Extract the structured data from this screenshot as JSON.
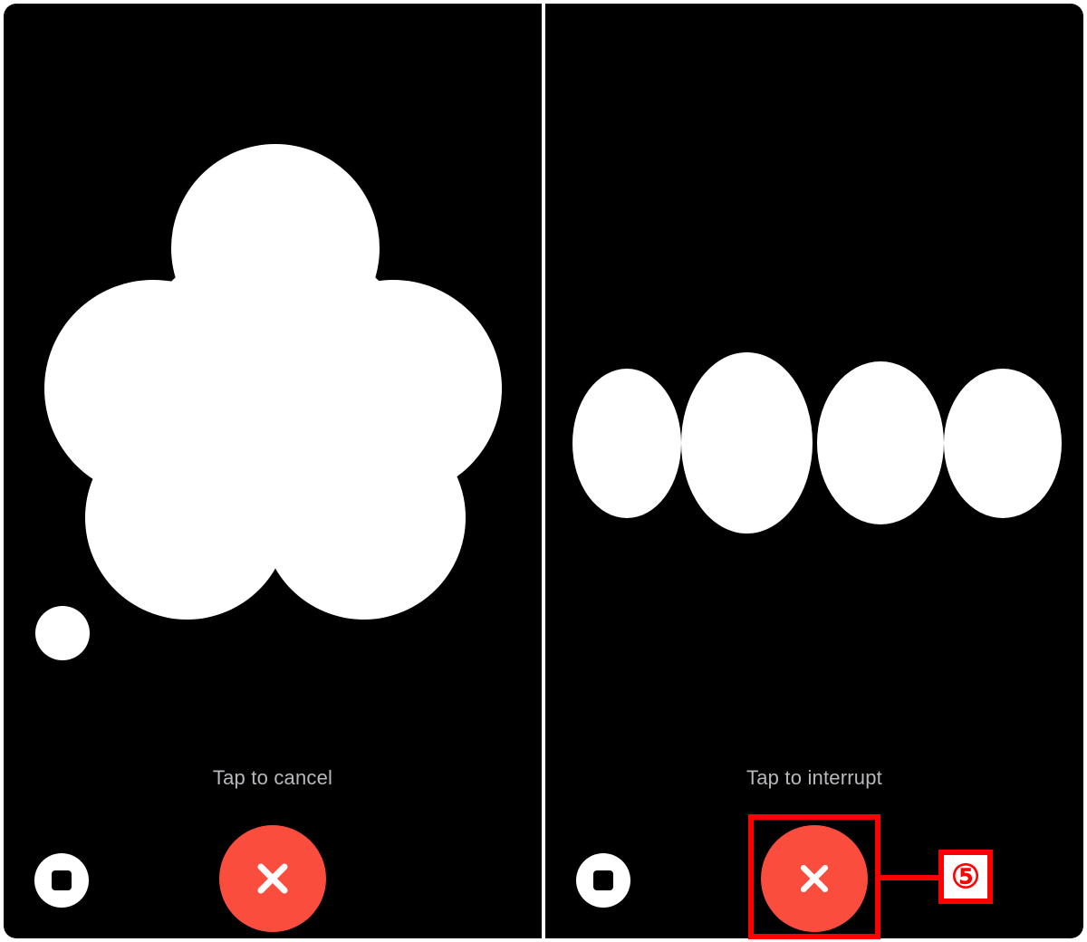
{
  "colors": {
    "accent_red": "#fb4d3d",
    "annotation_red": "#ff0000",
    "hint_text": "#b8b8be",
    "panel_bg": "#000000",
    "bubble_fill": "#ffffff"
  },
  "left_panel": {
    "hint_text": "Tap to cancel",
    "stop_icon": "stop-icon",
    "close_icon": "close-icon"
  },
  "right_panel": {
    "hint_text": "Tap to interrupt",
    "stop_icon": "stop-icon",
    "close_icon": "close-icon",
    "annotation_label": "⑤"
  }
}
